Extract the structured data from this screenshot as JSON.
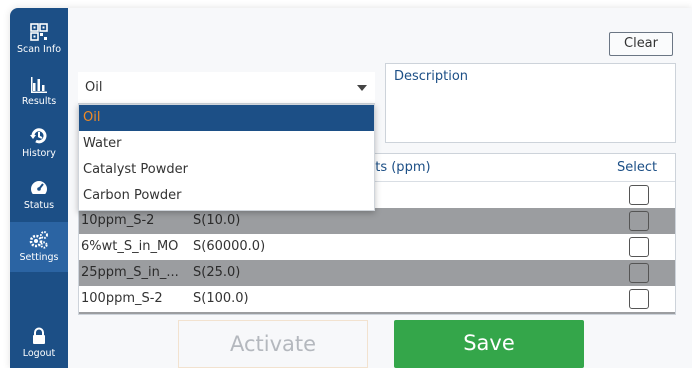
{
  "sidebar": {
    "items": [
      {
        "label": "Scan Info",
        "icon": "qr-code-icon"
      },
      {
        "label": "Results",
        "icon": "bar-chart-icon"
      },
      {
        "label": "History",
        "icon": "history-icon"
      },
      {
        "label": "Status",
        "icon": "gauge-icon"
      },
      {
        "label": "Settings",
        "icon": "gears-icon"
      },
      {
        "label": "Logout",
        "icon": "lock-icon"
      }
    ],
    "active": "Settings"
  },
  "header": {
    "clear_label": "Clear"
  },
  "matrix_select": {
    "value": "Oil",
    "options": [
      "Oil",
      "Water",
      "Catalyst Powder",
      "Carbon Powder"
    ],
    "selected_option": "Oil"
  },
  "description": {
    "label": "Description"
  },
  "table": {
    "elements_header": "ents (ppm)",
    "select_header": "Select",
    "rows": [
      {
        "name": "",
        "elements": ""
      },
      {
        "name": "10ppm_S-2",
        "elements": "S(10.0)"
      },
      {
        "name": "6%wt_S_in_MO",
        "elements": "S(60000.0)"
      },
      {
        "name": "25ppm_S_in_...",
        "elements": "S(25.0)"
      },
      {
        "name": "100ppm_S-2",
        "elements": "S(100.0)"
      }
    ]
  },
  "footer": {
    "activate_label": "Activate",
    "save_label": "Save"
  },
  "colors": {
    "sidebar": "#1c4f86",
    "selected_option_bg": "#1c4f86",
    "selected_option_text": "#f08a24",
    "save_button": "#34a64a",
    "gray_row": "#9b9da0"
  }
}
